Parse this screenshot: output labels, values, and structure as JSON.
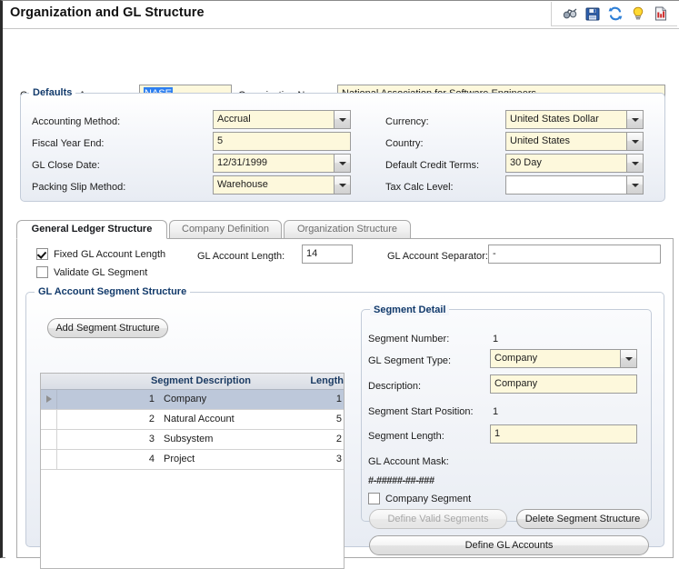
{
  "window": {
    "title": "Organization and GL Structure"
  },
  "toolbar": {
    "icons": [
      {
        "name": "find-binoculars-icon",
        "label": "Find"
      },
      {
        "name": "save-floppy-icon",
        "label": "Save"
      },
      {
        "name": "refresh-icon",
        "label": "Refresh"
      },
      {
        "name": "hint-lightbulb-icon",
        "label": "Hint"
      },
      {
        "name": "report-document-icon",
        "label": "Report"
      }
    ]
  },
  "header": {
    "acronym_label": "Organization Acronym:",
    "acronym_value": "NASE",
    "name_label": "Organization Name:",
    "name_value": "National Association for Software Engineers"
  },
  "defaults": {
    "title": "Defaults",
    "fields": [
      {
        "label": "Accounting Method:",
        "value": "Accrual",
        "type": "combo"
      },
      {
        "label": "Fiscal Year End:",
        "value": "5",
        "type": "text"
      },
      {
        "label": "GL Close Date:",
        "value": "12/31/1999",
        "type": "combo"
      },
      {
        "label": "Packing Slip Method:",
        "value": "Warehouse",
        "type": "combo"
      }
    ],
    "fields_right": [
      {
        "label": "Currency:",
        "value": "United States Dollar",
        "type": "combo"
      },
      {
        "label": "Country:",
        "value": "United States",
        "type": "combo"
      },
      {
        "label": "Default Credit Terms:",
        "value": "30 Day",
        "type": "combo"
      },
      {
        "label": "Tax Calc Level:",
        "value": "",
        "type": "combo"
      }
    ]
  },
  "tabs": [
    {
      "label": "General Ledger Structure",
      "active": true
    },
    {
      "label": "Company Definition",
      "active": false
    },
    {
      "label": "Organization Structure",
      "active": false
    }
  ],
  "gl_options": {
    "fixed_length_label": "Fixed GL Account Length",
    "fixed_length_checked": true,
    "validate_segment_label": "Validate GL Segment",
    "validate_segment_checked": false,
    "account_length_label": "GL Account Length:",
    "account_length_value": "14",
    "separator_label": "GL Account Separator:",
    "separator_value": "-"
  },
  "segment_structure": {
    "title": "GL Account Segment Structure",
    "add_button": "Add Segment Structure",
    "columns": [
      "",
      "",
      "Segment Description",
      "Length"
    ],
    "rows": [
      {
        "num": "1",
        "description": "Company",
        "length": "1",
        "selected": true
      },
      {
        "num": "2",
        "description": "Natural Account",
        "length": "5",
        "selected": false
      },
      {
        "num": "3",
        "description": "Subsystem",
        "length": "2",
        "selected": false
      },
      {
        "num": "4",
        "description": "Project",
        "length": "3",
        "selected": false
      }
    ]
  },
  "segment_detail": {
    "title": "Segment Detail",
    "segment_number_label": "Segment Number:",
    "segment_number_value": "1",
    "segment_type_label": "GL Segment Type:",
    "segment_type_value": "Company",
    "description_label": "Description:",
    "description_value": "Company",
    "start_position_label": "Segment Start Position:",
    "start_position_value": "1",
    "segment_length_label": "Segment Length:",
    "segment_length_value": "1",
    "account_mask_label": "GL Account Mask:",
    "account_mask_value": "#-#####-##-###",
    "company_segment_label": "Company Segment",
    "company_segment_checked": false,
    "define_valid_segments_button": "Define Valid Segments",
    "define_valid_segments_disabled": true,
    "delete_segment_button": "Delete Segment Structure"
  },
  "footer": {
    "define_gl_accounts_button": "Define GL Accounts"
  },
  "colors": {
    "field_yellow": "#fdf8dc",
    "group_title": "#123a6b",
    "selection_blue": "#2d7ff0",
    "row_selected": "#bdc8da",
    "grid_header": "#d9dde5"
  }
}
